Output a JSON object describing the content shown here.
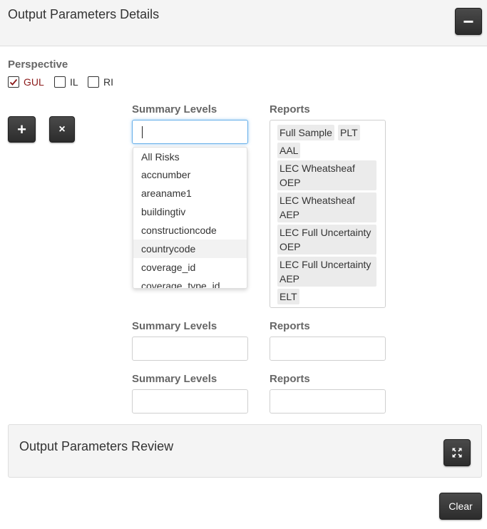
{
  "header": {
    "title": "Output Parameters Details",
    "collapse_label": "−"
  },
  "perspective": {
    "label": "Perspective",
    "options": [
      {
        "label": "GUL",
        "checked": true
      },
      {
        "label": "IL",
        "checked": false
      },
      {
        "label": "RI",
        "checked": false
      }
    ]
  },
  "actions": {
    "add_label": "+",
    "remove_label": "×"
  },
  "rows": [
    {
      "summary_label": "Summary Levels",
      "reports_label": "Reports",
      "summary_value": "",
      "dropdown": [
        "All Risks",
        "accnumber",
        "areaname1",
        "buildingtiv",
        "constructioncode",
        "countrycode",
        "coverage_id",
        "coverage_type_id"
      ],
      "dropdown_highlighted": "countrycode",
      "reports": [
        "Full Sample",
        "PLT",
        "AAL",
        "LEC Wheatsheaf OEP",
        "LEC Wheatsheaf AEP",
        "LEC Full Uncertainty OEP",
        "LEC Full Uncertainty AEP",
        "ELT"
      ]
    },
    {
      "summary_label": "Summary Levels",
      "reports_label": "Reports"
    },
    {
      "summary_label": "Summary Levels",
      "reports_label": "Reports"
    }
  ],
  "review": {
    "title": "Output Parameters Review"
  },
  "footer": {
    "clear_label": "Clear"
  },
  "colors": {
    "checked": "#8b1a1a",
    "focus": "#66afe9",
    "button_dark": "#333333"
  },
  "icons": {
    "collapse": "minus-icon",
    "add": "plus-icon",
    "remove": "times-icon",
    "expand": "expand-arrows-icon",
    "check": "check-icon"
  }
}
